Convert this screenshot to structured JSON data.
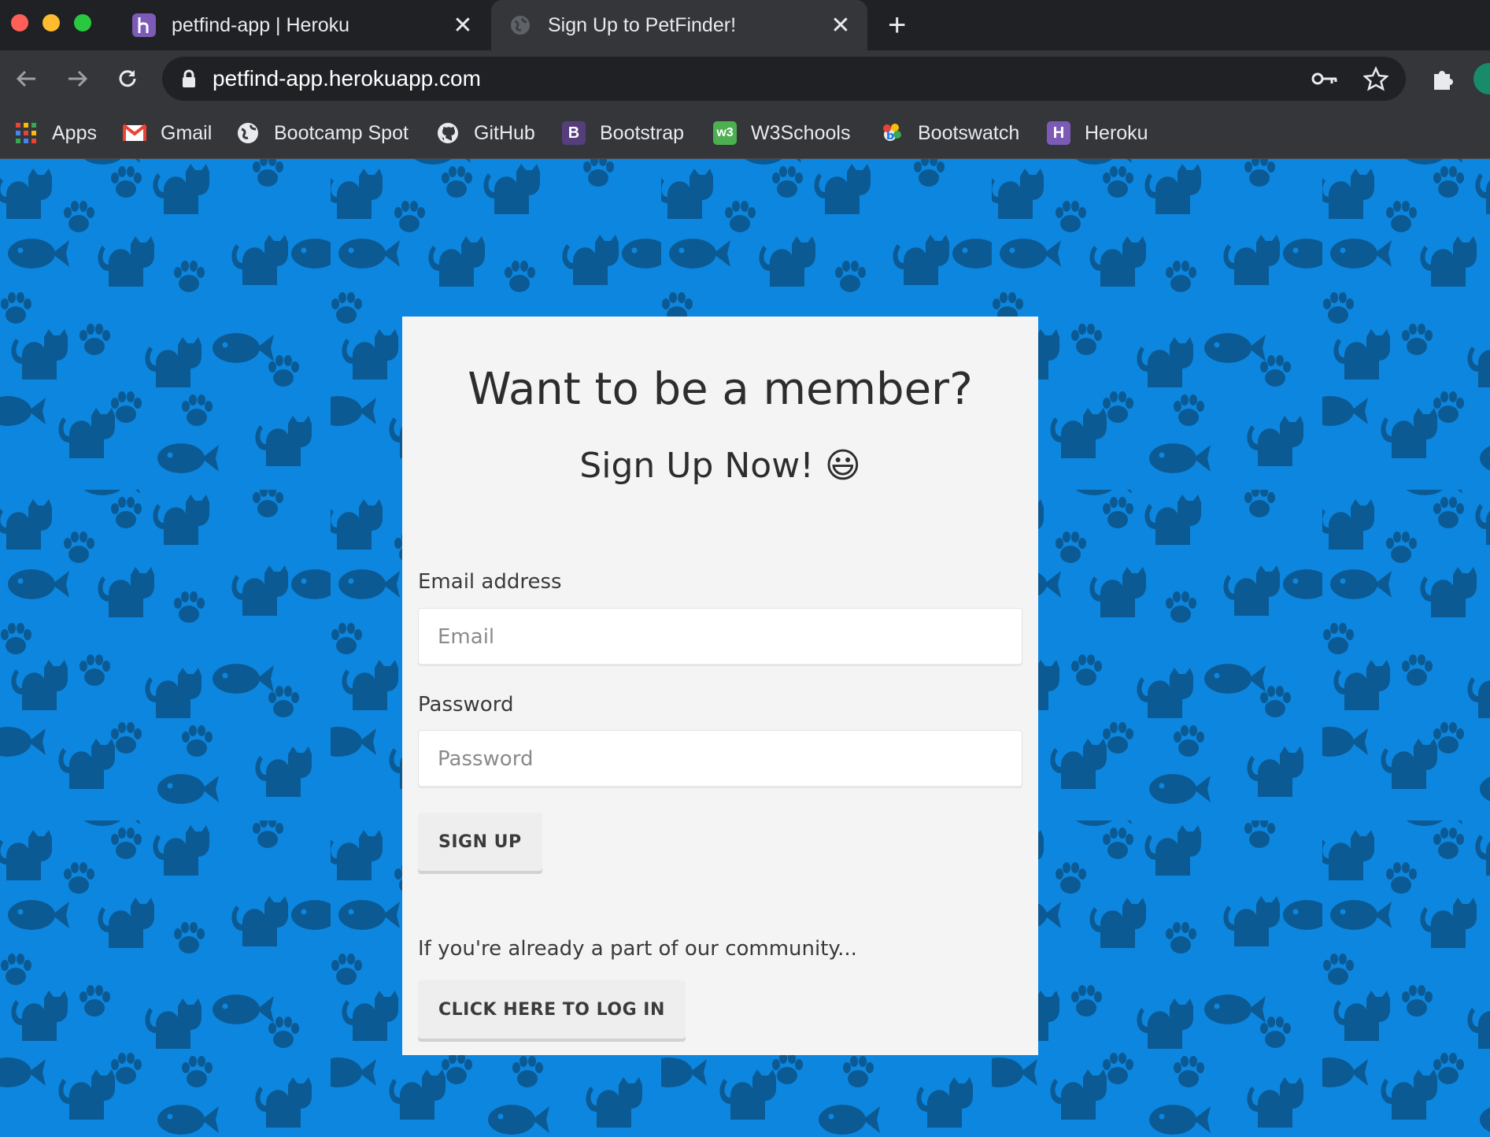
{
  "browser": {
    "tabs": [
      {
        "title": "petfind-app | Heroku",
        "icon": "heroku-icon",
        "active": false
      },
      {
        "title": "Sign Up to PetFinder!",
        "icon": "globe-icon",
        "active": true
      }
    ],
    "new_tab_label": "+",
    "url": "petfind-app.herokuapp.com",
    "bookmarks": [
      {
        "label": "Apps",
        "icon": "apps-grid-icon"
      },
      {
        "label": "Gmail",
        "icon": "gmail-icon"
      },
      {
        "label": "Bootcamp Spot",
        "icon": "globe-icon"
      },
      {
        "label": "GitHub",
        "icon": "github-icon"
      },
      {
        "label": "Bootstrap",
        "icon": "bootstrap-icon",
        "glyph": "B"
      },
      {
        "label": "W3Schools",
        "icon": "w3schools-icon",
        "glyph": "w3"
      },
      {
        "label": "Bootswatch",
        "icon": "bootswatch-icon"
      },
      {
        "label": "Heroku",
        "icon": "heroku-icon",
        "glyph": "H"
      }
    ]
  },
  "colors": {
    "page_background": "#0d86e0",
    "pattern_color": "#0b5a93",
    "card_background": "#f4f4f4",
    "heroku_purple": "#7b5bb6",
    "bootstrap_purple": "#563d7c",
    "w3_green": "#4caf50"
  },
  "signup": {
    "heading": "Want to be a member?",
    "subheading": "Sign Up Now! 😃",
    "email_label": "Email address",
    "email_placeholder": "Email",
    "password_label": "Password",
    "password_placeholder": "Password",
    "submit_label": "SIGN UP",
    "login_prompt": "If you're already a part of our community...",
    "login_button_label": "CLICK HERE TO LOG IN"
  }
}
